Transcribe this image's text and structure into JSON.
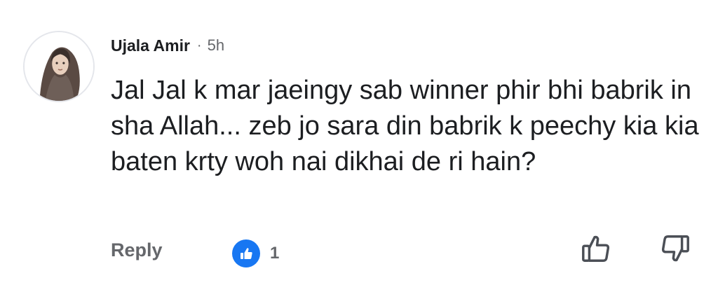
{
  "comment": {
    "author": "Ujala Amir",
    "separator": "·",
    "time": "5h",
    "text": "Jal Jal k mar jaeingy sab winner phir bhi babrik in sha Allah... zeb jo sara din babrik k peechy kia kia baten krty woh nai dikhai de ri hain?",
    "avatar_icon": "profile-avatar"
  },
  "actions": {
    "reply_label": "Reply",
    "reaction_icon": "like-reaction-icon",
    "reaction_count": "1",
    "like_icon": "thumbs-up-icon",
    "dislike_icon": "thumbs-down-icon"
  },
  "colors": {
    "accent": "#1877f2",
    "muted_text": "#65676b",
    "main_text": "#1c1e21"
  }
}
